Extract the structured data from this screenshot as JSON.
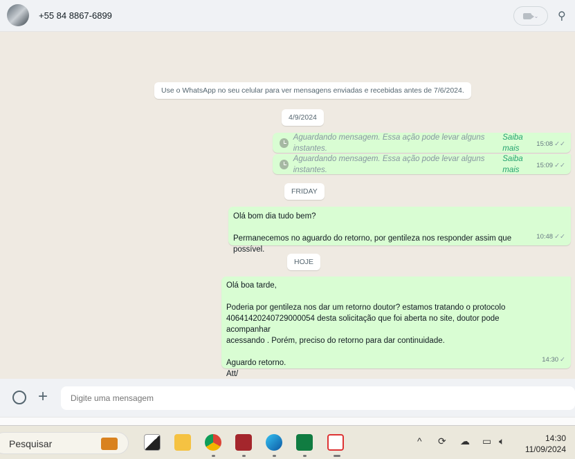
{
  "header": {
    "contact": "+55 84 8867-6899",
    "icons": [
      "avatar",
      "video-call-icon",
      "chevron-down-icon",
      "search-icon"
    ]
  },
  "chat": {
    "system_notice": "Use o WhatsApp no seu celular para ver mensagens enviadas e recebidas antes de 7/6/2024.",
    "dates": [
      "4/9/2024",
      "FRIDAY",
      "HOJE"
    ],
    "pending": [
      {
        "text": "Aguardando mensagem. Essa ação pode levar alguns instantes.",
        "link": "Saiba mais",
        "time": "15:08",
        "status": "✓✓"
      },
      {
        "text": "Aguardando mensagem. Essa ação pode levar alguns instantes.",
        "link": "Saiba mais",
        "time": "15:09",
        "status": "✓✓"
      }
    ],
    "messages": [
      {
        "text": "Olá bom dia tudo bem?\n\nPermanecemos no aguardo do retorno, por gentileza nos responder assim que possível.",
        "time": "10:48",
        "status": "✓✓"
      },
      {
        "text": "Olá boa tarde,\n\nPoderia por gentileza nos dar um retorno doutor? estamos tratando o protocolo\n40641420240729000054 desta solicitação que foi aberta no site, doutor pode acompanhar\nacessando . Porém, preciso do retorno para dar continuidade.\n\nAguardo retorno.\nAtt/",
        "time": "14:30",
        "status": "✓"
      }
    ]
  },
  "footer": {
    "placeholder": "Digite uma mensagem"
  },
  "taskbar": {
    "search": "Pesquisar",
    "time": "14:30",
    "date": "11/09/2024"
  },
  "colors": {
    "bubble": "#d9fdd3",
    "chat_bg": "#efeae2",
    "header_bg": "#f0f2f5",
    "link": "#25a36f"
  }
}
